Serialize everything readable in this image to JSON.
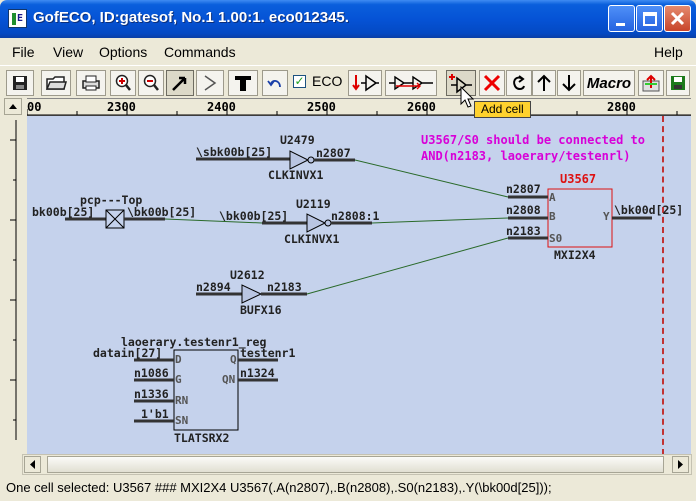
{
  "window": {
    "title": "GofECO, ID:gatesof, No.1 1.00:1. eco012345.",
    "app_icon": "gofeco-app-icon"
  },
  "menu": {
    "file": "File",
    "view": "View",
    "options": "Options",
    "commands": "Commands",
    "help": "Help"
  },
  "toolbar": {
    "eco_label": "ECO",
    "eco_checked": true,
    "macro_label": "Macro",
    "tooltip": "Add cell"
  },
  "ruler": {
    "ticks": [
      "00",
      "2300",
      "2400",
      "2500",
      "2600",
      "2800"
    ]
  },
  "schematic": {
    "note_line1": "U3567/S0 should be connected to",
    "note_line2": "AND(n2183, laoerary/testenrl)",
    "u2479": {
      "name": "U2479",
      "type": "CLKINVX1",
      "in": "\\sbk00b[25]",
      "out": "n2807"
    },
    "port": {
      "name": "pcp---Top",
      "left": "bk00b[25]",
      "right": "\\bk00b[25]"
    },
    "u2119": {
      "name": "U2119",
      "type": "CLKINVX1",
      "in": "\\bk00b[25]",
      "out": "n2808:1"
    },
    "u2612": {
      "name": "U2612",
      "type": "BUFX16",
      "in": "n2894",
      "out": "n2183"
    },
    "u3567": {
      "name": "U3567",
      "type": "MXI2X4",
      "a": "n2807",
      "b": "n2808",
      "s0": "n2183",
      "y": "\\bk00d[25]",
      "pin_a": "A",
      "pin_b": "B",
      "pin_s0": "S0",
      "pin_y": "Y"
    },
    "reg": {
      "name": "laoerary.testenr1_reg",
      "type": "TLATSRX2",
      "d": "datain[27]",
      "g": "n1086",
      "rn": "n1336",
      "sn": "1'b1",
      "q": "testenr1",
      "qn": "n1324",
      "pin_d": "D",
      "pin_g": "G",
      "pin_rn": "RN",
      "pin_sn": "SN",
      "pin_q": "Q",
      "pin_qn": "QN"
    }
  },
  "status": {
    "text": "One cell selected: U3567 ### MXI2X4 U3567(.A(n2807),.B(n2808),.S0(n2183),.Y(\\bk00d[25]));"
  }
}
